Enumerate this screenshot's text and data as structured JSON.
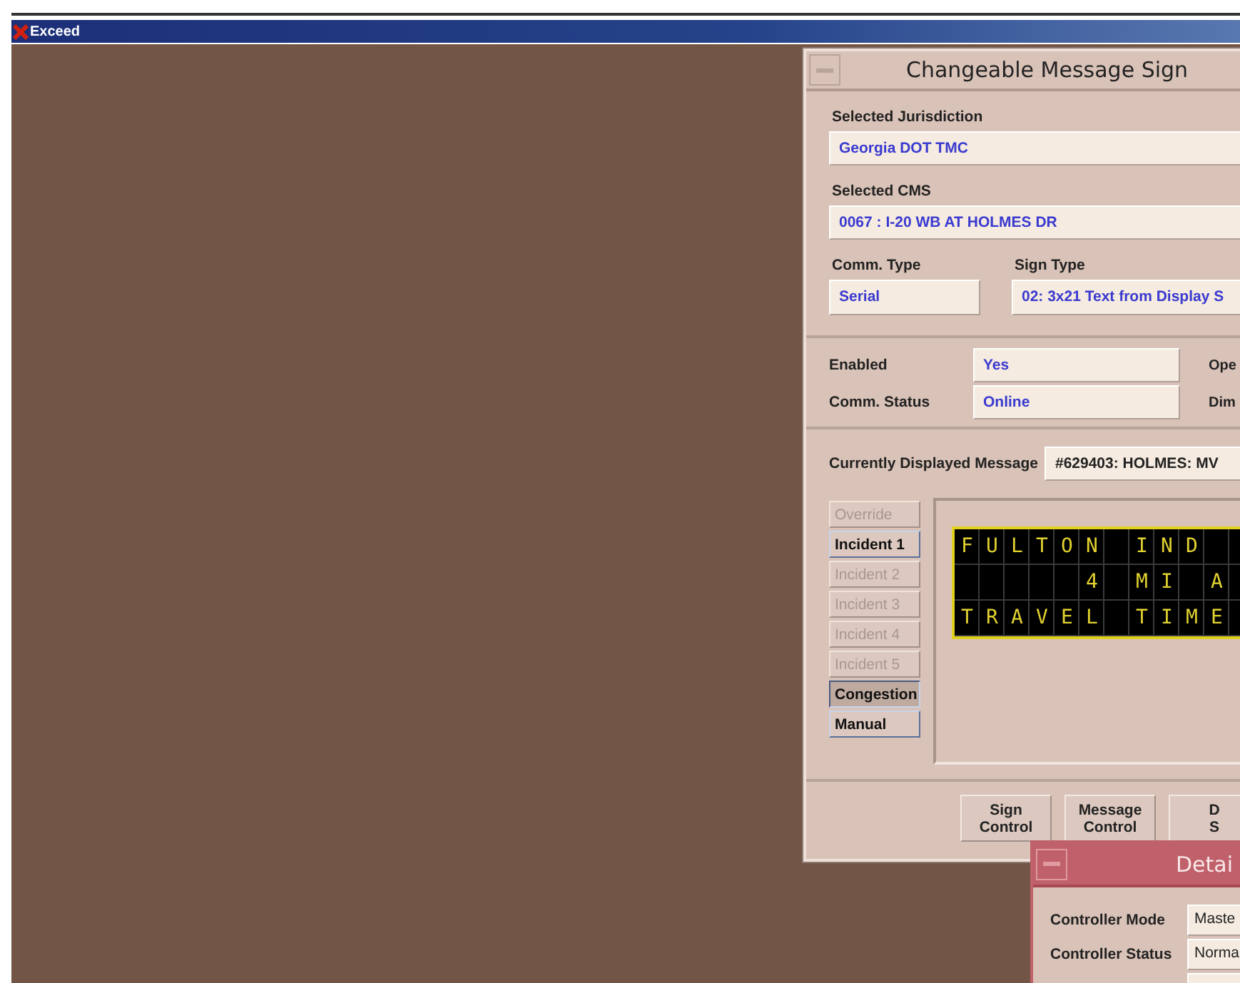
{
  "app_bar": {
    "title": "Exceed"
  },
  "cms_window": {
    "title": "Changeable Message Sign",
    "jurisdiction": {
      "label": "Selected Jurisdiction",
      "value": "Georgia DOT TMC"
    },
    "cms": {
      "label": "Selected CMS",
      "value": "0067 : I-20 WB AT HOLMES DR"
    },
    "comm_type": {
      "label": "Comm. Type",
      "value": "Serial"
    },
    "sign_type": {
      "label": "Sign Type",
      "value": "02: 3x21 Text from Display S"
    },
    "status_rows": [
      {
        "label": "Enabled",
        "value": "Yes",
        "side_label": "Ope"
      },
      {
        "label": "Comm. Status",
        "value": "Online",
        "side_label": "Dim"
      }
    ],
    "current_message": {
      "label": "Currently Displayed Message",
      "value": "#629403:  HOLMES: MV"
    },
    "message_buttons": [
      {
        "label": "Override",
        "disabled": true,
        "selected": false
      },
      {
        "label": "Incident 1",
        "disabled": false,
        "selected": false
      },
      {
        "label": "Incident 2",
        "disabled": true,
        "selected": false
      },
      {
        "label": "Incident 3",
        "disabled": true,
        "selected": false
      },
      {
        "label": "Incident 4",
        "disabled": true,
        "selected": false
      },
      {
        "label": "Incident 5",
        "disabled": true,
        "selected": false
      },
      {
        "label": "Congestion",
        "disabled": false,
        "selected": true
      },
      {
        "label": "Manual",
        "disabled": false,
        "selected": false
      }
    ],
    "sign_rows": [
      "FULTON IND",
      "     4 MI A",
      "TRAVEL TIME"
    ],
    "bottom_buttons": [
      {
        "lines": [
          "Sign",
          "Control"
        ]
      },
      {
        "lines": [
          "Message",
          "Control"
        ]
      },
      {
        "lines": [
          "D",
          "S"
        ]
      }
    ]
  },
  "detail_window": {
    "title": "Detai",
    "fields": [
      {
        "label": "Controller Mode",
        "value": "Maste"
      },
      {
        "label": "Controller Status",
        "value": "Norma"
      }
    ]
  }
}
